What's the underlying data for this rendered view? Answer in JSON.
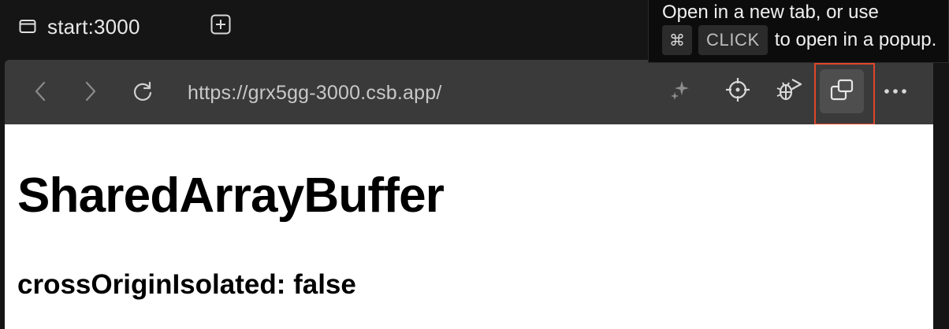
{
  "tab": {
    "label": "start:3000"
  },
  "tooltip": {
    "line1": "Open in a new tab, or use",
    "key_cmd": "⌘",
    "key_click": "CLICK",
    "line2_rest": "to open in a popup."
  },
  "browser": {
    "url": "https://grx5gg-3000.csb.app/"
  },
  "page": {
    "heading": "SharedArrayBuffer",
    "subheading": "crossOriginIsolated: false"
  },
  "colors": {
    "highlight": "#e0462c",
    "toolbar": "#3a3a3a",
    "chrome": "#151515"
  },
  "icons": [
    "window-icon",
    "plus-square-icon",
    "chevron-left-icon",
    "chevron-right-icon",
    "reload-icon",
    "sparkle-icon",
    "crosshair-icon",
    "bug-play-icon",
    "open-popup-icon",
    "more-icon"
  ]
}
